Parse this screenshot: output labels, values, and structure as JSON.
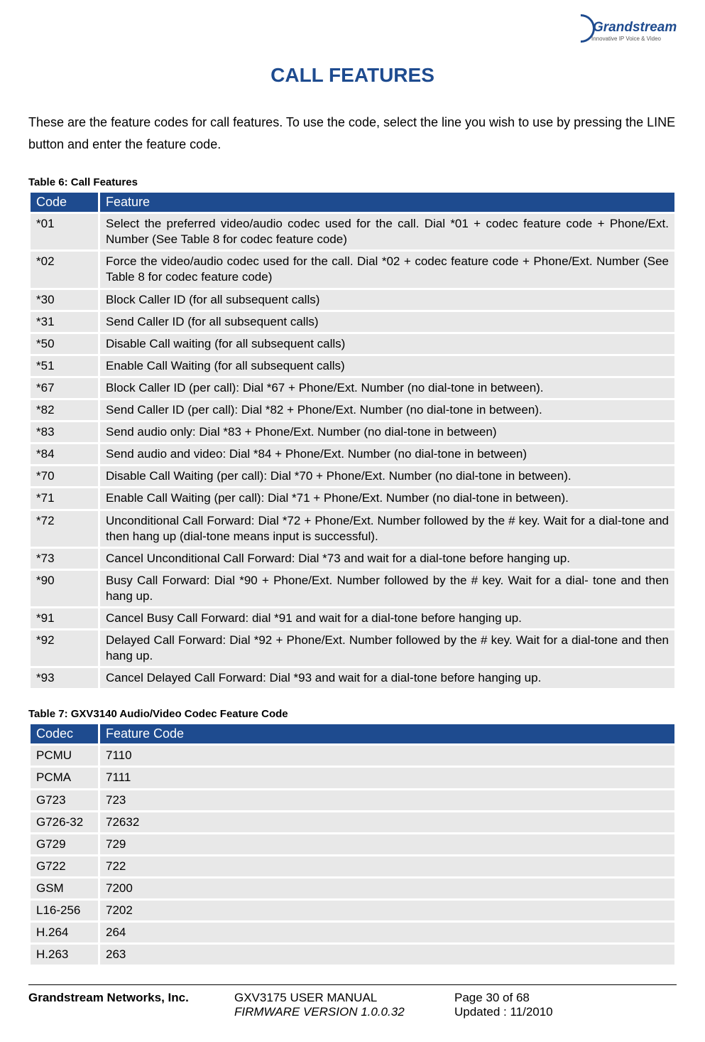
{
  "logo": {
    "brand": "Grandstream",
    "tagline": "Innovative IP Voice & Video"
  },
  "title": "CALL FEATURES",
  "intro": "These are the feature codes for call features. To use the code, select the line you wish to use by pressing the LINE button and enter the feature code.",
  "table6": {
    "caption": "Table 6: Call Features",
    "headers": {
      "code": "Code",
      "feature": "Feature"
    },
    "rows": [
      {
        "code": "*01",
        "feature": "Select the preferred video/audio codec used for the call. Dial *01 + codec feature code + Phone/Ext. Number (See Table 8 for codec feature code)"
      },
      {
        "code": "*02",
        "feature": "Force the video/audio codec used for the call. Dial *02 + codec feature code + Phone/Ext. Number (See Table 8 for codec feature code)"
      },
      {
        "code": "*30",
        "feature": "Block Caller ID (for all subsequent calls)"
      },
      {
        "code": "*31",
        "feature": "Send Caller ID (for all subsequent calls)"
      },
      {
        "code": "*50",
        "feature": "Disable Call waiting (for all subsequent calls)"
      },
      {
        "code": "*51",
        "feature": "Enable Call Waiting (for all subsequent calls)"
      },
      {
        "code": "*67",
        "feature": "Block Caller ID (per call): Dial *67 + Phone/Ext. Number (no dial-tone in between)."
      },
      {
        "code": "*82",
        "feature": "Send Caller ID (per call): Dial *82 + Phone/Ext. Number (no dial-tone in between)."
      },
      {
        "code": "*83",
        "feature": "Send audio only: Dial *83 + Phone/Ext. Number (no dial-tone in between)"
      },
      {
        "code": "*84",
        "feature": "Send audio and video: Dial *84 + Phone/Ext. Number (no dial-tone in between)"
      },
      {
        "code": "*70",
        "feature": "Disable Call Waiting (per call): Dial *70 + Phone/Ext. Number (no dial-tone in between)."
      },
      {
        "code": "*71",
        "feature": "Enable Call Waiting (per call): Dial *71 + Phone/Ext. Number (no dial-tone in between)."
      },
      {
        "code": "*72",
        "feature": "Unconditional Call Forward: Dial *72 + Phone/Ext. Number followed by the # key. Wait for a dial-tone and then hang up (dial-tone means input is successful)."
      },
      {
        "code": "*73",
        "feature": "Cancel Unconditional Call Forward: Dial *73 and wait for a dial-tone before hanging up."
      },
      {
        "code": "*90",
        "feature": "Busy Call Forward: Dial *90 + Phone/Ext. Number followed by the # key. Wait for a dial- tone and then hang up."
      },
      {
        "code": "*91",
        "feature": "Cancel Busy Call Forward: dial *91 and wait for a dial-tone before hanging up."
      },
      {
        "code": "*92",
        "feature": "Delayed Call Forward: Dial *92 + Phone/Ext. Number followed by the # key. Wait for a dial-tone and then hang up."
      },
      {
        "code": "*93",
        "feature": "Cancel Delayed Call Forward: Dial *93 and wait for a dial-tone before hanging up."
      }
    ]
  },
  "table7": {
    "caption": "Table 7: GXV3140 Audio/Video Codec Feature Code",
    "headers": {
      "codec": "Codec",
      "fcode": "Feature Code"
    },
    "rows": [
      {
        "codec": "PCMU",
        "fcode": "7110"
      },
      {
        "codec": "PCMA",
        "fcode": "7111"
      },
      {
        "codec": "G723",
        "fcode": "723"
      },
      {
        "codec": "G726-32",
        "fcode": "72632"
      },
      {
        "codec": "G729",
        "fcode": "729"
      },
      {
        "codec": "G722",
        "fcode": "722"
      },
      {
        "codec": "GSM",
        "fcode": "7200"
      },
      {
        "codec": "L16-256",
        "fcode": "7202"
      },
      {
        "codec": "H.264",
        "fcode": "264"
      },
      {
        "codec": "H.263",
        "fcode": "263"
      }
    ]
  },
  "footer": {
    "company": "Grandstream Networks, Inc.",
    "manual": "GXV3175 USER MANUAL",
    "firmware": "FIRMWARE VERSION 1.0.0.32",
    "page": "Page 30 of 68",
    "updated": "Updated : 11/2010"
  }
}
